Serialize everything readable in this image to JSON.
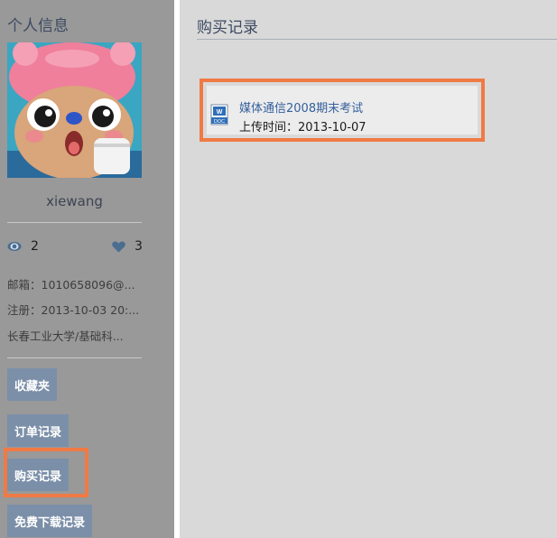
{
  "sidebar": {
    "title": "个人信息",
    "username": "xiewang",
    "stats": {
      "views": "2",
      "likes": "3"
    },
    "info": {
      "email": "邮箱：1010658096@...",
      "register": "注册：2013-10-03 20:...",
      "school": "长春工业大学/基础科..."
    },
    "nav": [
      {
        "label": "收藏夹"
      },
      {
        "label": "订单记录"
      },
      {
        "label": "购买记录"
      },
      {
        "label": "免费下载记录"
      }
    ]
  },
  "main": {
    "title": "购买记录",
    "records": [
      {
        "icon": "doc-file-icon",
        "title": "媒体通信2008期末考试",
        "upload": "上传时间：2013-10-07"
      }
    ]
  },
  "colors": {
    "accent_highlight": "#f07a45",
    "nav_button": "#7b8fa8",
    "link": "#34609c"
  }
}
